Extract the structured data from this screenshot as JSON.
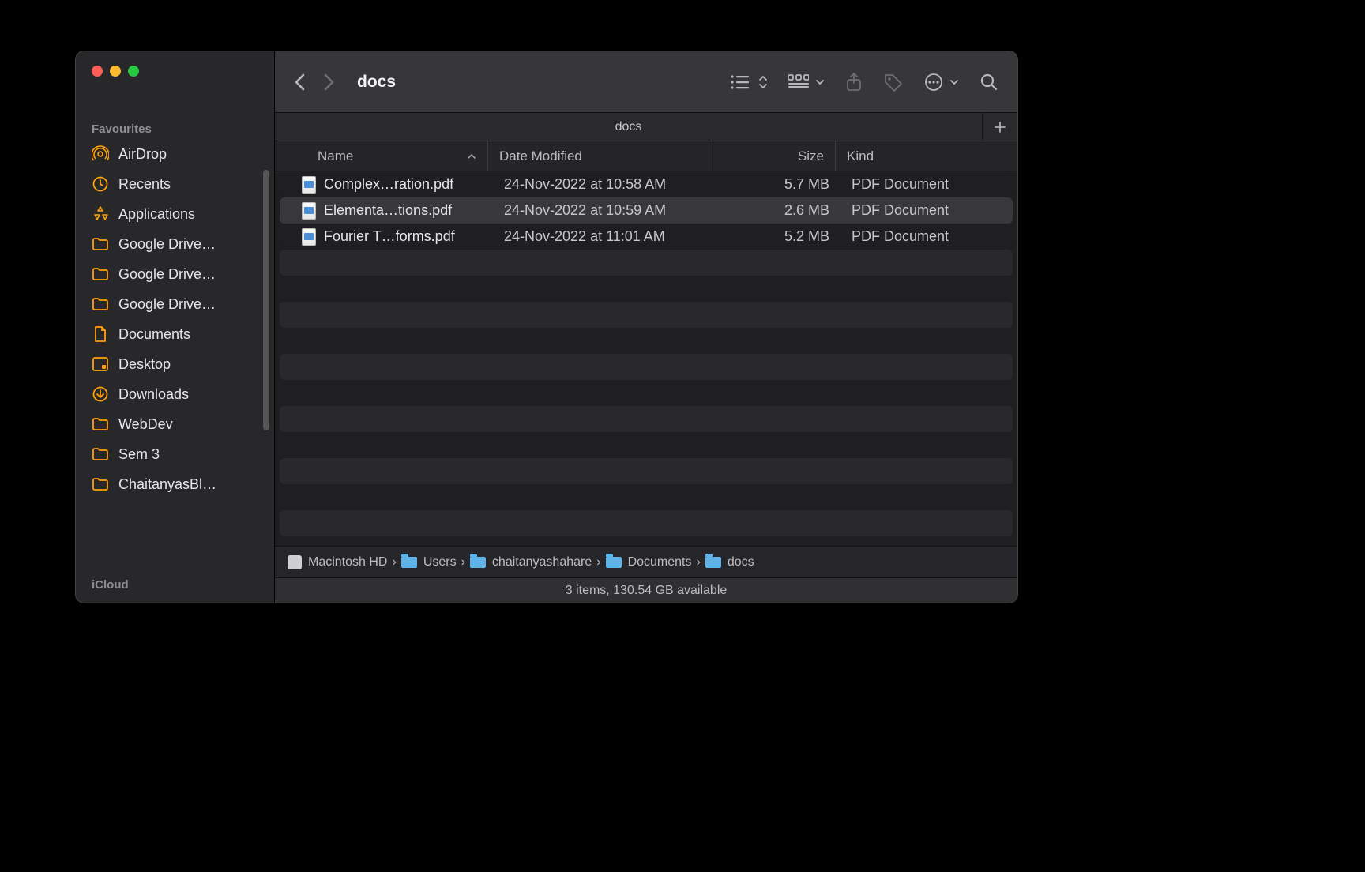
{
  "window": {
    "title": "docs"
  },
  "tabs": [
    {
      "label": "docs"
    }
  ],
  "sidebar": {
    "favs_label": "Favourites",
    "icloud_label": "iCloud",
    "items": [
      {
        "label": "AirDrop",
        "icon": "airdrop"
      },
      {
        "label": "Recents",
        "icon": "clock"
      },
      {
        "label": "Applications",
        "icon": "apps"
      },
      {
        "label": "Google Drive…",
        "icon": "folder"
      },
      {
        "label": "Google Drive…",
        "icon": "folder"
      },
      {
        "label": "Google Drive…",
        "icon": "folder"
      },
      {
        "label": "Documents",
        "icon": "document"
      },
      {
        "label": "Desktop",
        "icon": "desktop"
      },
      {
        "label": "Downloads",
        "icon": "download"
      },
      {
        "label": "WebDev",
        "icon": "folder"
      },
      {
        "label": "Sem 3",
        "icon": "folder"
      },
      {
        "label": "ChaitanyasBl…",
        "icon": "folder"
      }
    ]
  },
  "columns": {
    "name": "Name",
    "date": "Date Modified",
    "size": "Size",
    "kind": "Kind"
  },
  "files": [
    {
      "name": "Complex…ration.pdf",
      "date": "24-Nov-2022 at 10:58 AM",
      "size": "5.7 MB",
      "kind": "PDF Document",
      "selected": false
    },
    {
      "name": "Elementa…tions.pdf",
      "date": "24-Nov-2022 at 10:59 AM",
      "size": "2.6 MB",
      "kind": "PDF Document",
      "selected": true
    },
    {
      "name": "Fourier T…forms.pdf",
      "date": "24-Nov-2022 at 11:01 AM",
      "size": "5.2 MB",
      "kind": "PDF Document",
      "selected": false
    }
  ],
  "path": [
    {
      "label": "Macintosh HD",
      "icon": "disk"
    },
    {
      "label": "Users",
      "icon": "folder"
    },
    {
      "label": "chaitanyashahare",
      "icon": "folder"
    },
    {
      "label": "Documents",
      "icon": "folder"
    },
    {
      "label": "docs",
      "icon": "folder"
    }
  ],
  "status": "3 items, 130.54 GB available"
}
